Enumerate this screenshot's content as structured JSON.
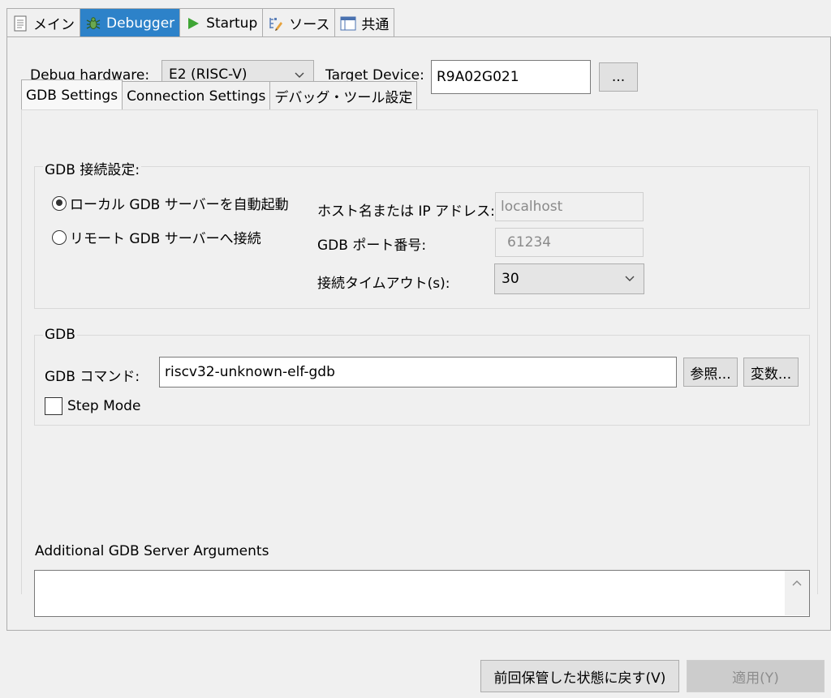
{
  "top_tabs": [
    {
      "label": "メイン",
      "icon": "document-icon"
    },
    {
      "label": "Debugger",
      "icon": "bug-icon"
    },
    {
      "label": "Startup",
      "icon": "play-icon"
    },
    {
      "label": "ソース",
      "icon": "source-lookup-icon"
    },
    {
      "label": "共通",
      "icon": "common-icon"
    }
  ],
  "debugger": {
    "debug_hardware_label": "Debug hardware:",
    "debug_hardware_value": "E2 (RISC-V)",
    "target_device_label": "Target Device:",
    "target_device_value": "R9A02G021",
    "browse_device_label": "..."
  },
  "inner_tabs": [
    "GDB Settings",
    "Connection Settings",
    "デバッグ・ツール設定"
  ],
  "gdb_connection": {
    "title": "GDB 接続設定:",
    "radio_local": "ローカル GDB サーバーを自動起動",
    "radio_remote": "リモート GDB サーバーへ接続",
    "host_label": "ホスト名または IP アドレス:",
    "host_value": "localhost",
    "port_label": "GDB ポート番号:",
    "port_value": "61234",
    "timeout_label": "接続タイムアウト(s):",
    "timeout_value": "30"
  },
  "gdb": {
    "title": "GDB",
    "command_label": "GDB コマンド:",
    "command_value": "riscv32-unknown-elf-gdb",
    "browse_label": "参照...",
    "variables_label": "変数...",
    "step_mode_label": "Step Mode"
  },
  "additional_args_label": "Additional GDB Server Arguments",
  "footer": {
    "revert_label": "前回保管した状態に戻す(V)",
    "apply_label": "適用(Y)"
  },
  "colors": {
    "active_tab": "#2d82c9",
    "panel_bg": "#f0f0f0"
  }
}
